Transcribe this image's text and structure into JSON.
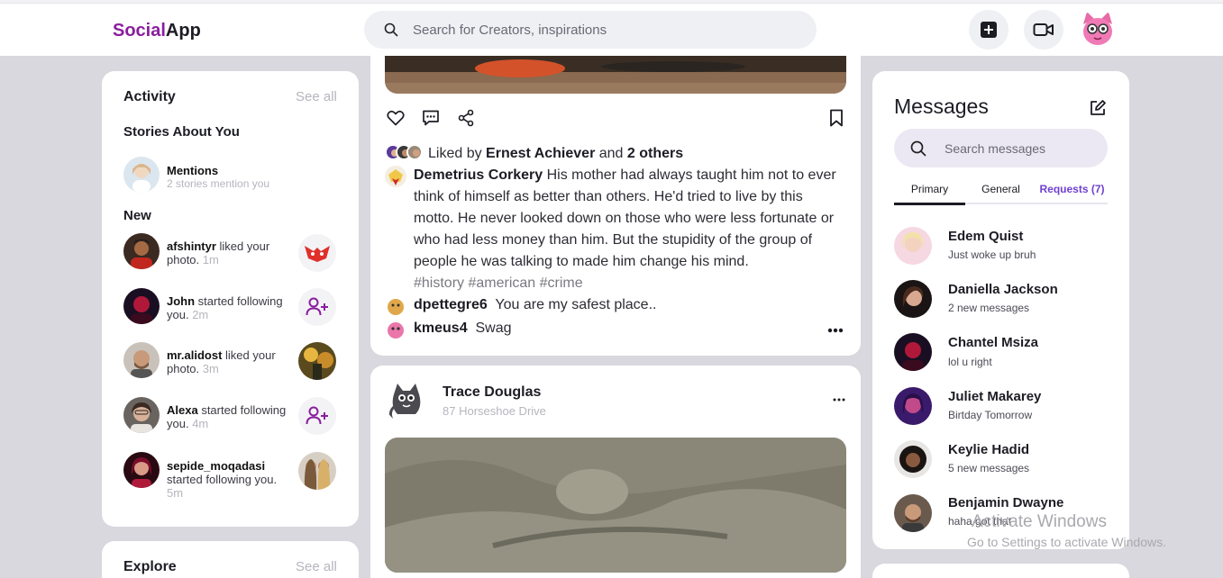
{
  "app": {
    "logo_part1": "Social",
    "logo_part2": "App"
  },
  "header": {
    "search_placeholder": "Search for Creators, inspirations"
  },
  "activity": {
    "title": "Activity",
    "see_all": "See all",
    "stories_heading": "Stories About You",
    "mentions": {
      "label": "Mentions",
      "sub": "2 stories mention you"
    },
    "new_heading": "New",
    "items": [
      {
        "user": "afshintyr",
        "action": " liked your photo.",
        "time": "1m"
      },
      {
        "user": "John",
        "action": " started following you.",
        "time": "2m"
      },
      {
        "user": "mr.alidost",
        "action": " liked your photo.",
        "time": "3m"
      },
      {
        "user": "Alexa",
        "action": " started following you.",
        "time": "4m"
      },
      {
        "user": "sepide_moqadasi",
        "action": " started following you.",
        "time": "5m"
      }
    ]
  },
  "explore": {
    "title": "Explore",
    "see_all": "See all"
  },
  "post1": {
    "liked_prefix": "Liked by ",
    "liked_user": "Ernest Achiever",
    "liked_and": " and ",
    "liked_others": "2 others",
    "caption_user": "Demetrius Corkery",
    "caption": "His mother had always taught him not to ever think of himself as better than others. He'd tried to live by this motto. He never looked down on those who were less fortunate or who had less money than him. But the stupidity of the group of people he was talking to made him change his mind.",
    "tags": "#history #american #crime",
    "comments": [
      {
        "user": "dpettegre6",
        "text": "You are my safest place.."
      },
      {
        "user": "kmeus4",
        "text": "Swag"
      }
    ]
  },
  "post2": {
    "author": "Trace Douglas",
    "location": "87 Horseshoe Drive"
  },
  "messages": {
    "title": "Messages",
    "search_placeholder": "Search messages",
    "tabs": [
      "Primary",
      "General",
      "Requests (7)"
    ],
    "items": [
      {
        "name": "Edem Quist",
        "text": "Just woke up bruh"
      },
      {
        "name": "Daniella Jackson",
        "text": "2 new messages"
      },
      {
        "name": "Chantel Msiza",
        "text": "lol u right"
      },
      {
        "name": "Juliet Makarey",
        "text": "Birtday Tomorrow"
      },
      {
        "name": "Keylie Hadid",
        "text": "5 new messages"
      },
      {
        "name": "Benjamin Dwayne",
        "text": "haha got that"
      }
    ]
  },
  "watermark": {
    "line1": "Activate Windows",
    "line2": "Go to Settings to activate Windows."
  },
  "colors": {
    "brand": "#8a1e9e",
    "accent": "#7040d0",
    "background": "#d8d8de"
  },
  "icons": [
    "search-icon",
    "add-post-icon",
    "video-icon",
    "heart-icon",
    "comment-icon",
    "share-icon",
    "bookmark-icon",
    "more-icon",
    "edit-icon",
    "add-user-icon"
  ]
}
